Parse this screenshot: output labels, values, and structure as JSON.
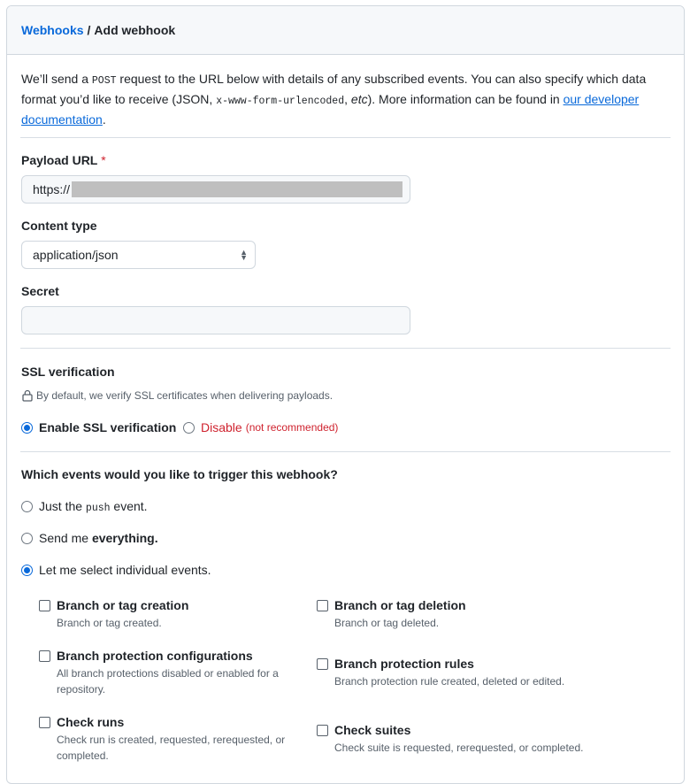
{
  "breadcrumb": {
    "parent": "Webhooks",
    "separator": "/",
    "current": "Add webhook"
  },
  "intro": {
    "part1": "We’ll send a ",
    "code1": "POST",
    "part2": " request to the URL below with details of any subscribed events. You can also specify which data format you’d like to receive (JSON, ",
    "code2": "x-www-form-urlencoded",
    "part3": ", ",
    "etc": "etc",
    "part4": "). More information can be found in ",
    "link": "our developer documentation",
    "part5": "."
  },
  "payload_url": {
    "label": "Payload URL",
    "required_mark": "*",
    "value": "https://"
  },
  "content_type": {
    "label": "Content type",
    "selected": "application/json"
  },
  "secret": {
    "label": "Secret",
    "value": ""
  },
  "ssl": {
    "label": "SSL verification",
    "note": "By default, we verify SSL certificates when delivering payloads.",
    "enable_label": "Enable SSL verification",
    "disable_label": "Disable",
    "disable_note": "(not recommended)"
  },
  "events": {
    "question": "Which events would you like to trigger this webhook?",
    "opt_push_pre": "Just the ",
    "opt_push_code": "push",
    "opt_push_post": " event.",
    "opt_all_pre": "Send me ",
    "opt_all_bold": "everything.",
    "opt_select": "Let me select individual events.",
    "items": [
      {
        "title": "Branch or tag creation",
        "desc": "Branch or tag created."
      },
      {
        "title": "Branch or tag deletion",
        "desc": "Branch or tag deleted."
      },
      {
        "title": "Branch protection configurations",
        "desc": "All branch protections disabled or enabled for a repository."
      },
      {
        "title": "Branch protection rules",
        "desc": "Branch protection rule created, deleted or edited."
      },
      {
        "title": "Check runs",
        "desc": "Check run is created, requested, rerequested, or completed."
      },
      {
        "title": "Check suites",
        "desc": "Check suite is requested, rerequested, or completed."
      }
    ]
  }
}
